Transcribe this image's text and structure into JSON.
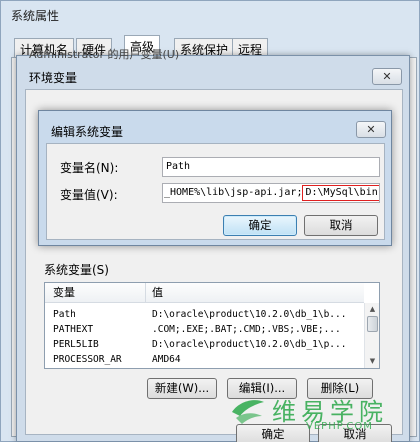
{
  "system_properties": {
    "title": "系统属性",
    "tabs": [
      {
        "label": "计算机名",
        "active": false
      },
      {
        "label": "硬件",
        "active": false
      },
      {
        "label": "高级",
        "active": true
      },
      {
        "label": "系统保护",
        "active": false
      },
      {
        "label": "远程",
        "active": false
      }
    ],
    "ok_label": "确定",
    "cancel_label": "取消"
  },
  "environment_variables": {
    "title": "环境变量",
    "close_label": "✕",
    "user_group_label": "Administrator 的用户变量(U)",
    "system_group_label": "系统变量(S)",
    "columns": {
      "name": "变量",
      "value": "值"
    },
    "rows": [
      {
        "name": "Path",
        "value": "D:\\oracle\\product\\10.2.0\\db_1\\b..."
      },
      {
        "name": "PATHEXT",
        "value": ".COM;.EXE;.BAT;.CMD;.VBS;.VBE;..."
      },
      {
        "name": "PERL5LIB",
        "value": "D:\\oracle\\product\\10.2.0\\db_1\\p..."
      },
      {
        "name": "PROCESSOR_AR",
        "value": "AMD64"
      }
    ],
    "buttons": {
      "new": "新建(W)...",
      "edit": "编辑(I)...",
      "delete": "删除(L)"
    }
  },
  "edit_dialog": {
    "title": "编辑系统变量",
    "close_label": "✕",
    "name_label": "变量名(N):",
    "name_value": "Path",
    "value_label": "变量值(V):",
    "value_text": "_HOME%\\lib\\jsp-api.jar;",
    "value_highlight": "D:\\MySql\\bin",
    "ok_label": "确定",
    "cancel_label": "取消"
  },
  "watermark": {
    "text": "维易学院",
    "url": "VEPHP.COM",
    "color": "#2ba84a"
  },
  "colors": {
    "highlight_box": "#e02020",
    "default_button": "#3c7fb1"
  }
}
